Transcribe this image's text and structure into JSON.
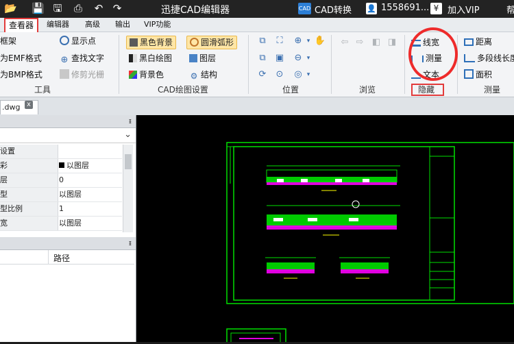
{
  "titlebar": {
    "title": "迅捷CAD编辑器",
    "cad_badge": "CAD",
    "convert_label": "CAD转换",
    "account": "1558691...",
    "vip_label": "加入VIP",
    "extra": "帮"
  },
  "menu": {
    "tabs": [
      "查看器",
      "编辑器",
      "高级",
      "输出",
      "VIP功能"
    ]
  },
  "ribbon": {
    "tools": {
      "items": [
        "框架",
        "为EMF格式",
        "为BMP格式",
        "显示点",
        "查找文字",
        "修剪光栅"
      ],
      "label": "工具"
    },
    "cad_settings": {
      "items": [
        "黑色背景",
        "圆滑弧形",
        "黑白绘图",
        "图层",
        "背景色",
        "结构"
      ],
      "label": "CAD绘图设置"
    },
    "position": {
      "label": "位置"
    },
    "browse": {
      "label": "浏览"
    },
    "hide": {
      "items": [
        "线宽",
        "测量",
        "文本"
      ],
      "label": "隐藏"
    },
    "measure": {
      "items": [
        "距离",
        "多段线长度",
        "面积"
      ],
      "label": "测量"
    }
  },
  "document": {
    "tab_label": ".dwg",
    "close": "x"
  },
  "properties": {
    "pin": "ᵻ",
    "dropdown_arrow": "⌄",
    "rows": [
      {
        "key": "设置",
        "value": ""
      },
      {
        "key": "彩",
        "value": "以图层"
      },
      {
        "key": "层",
        "value": "0"
      },
      {
        "key": "型",
        "value": "以图层"
      },
      {
        "key": "型比例",
        "value": "1"
      },
      {
        "key": "宽",
        "value": "以图层"
      }
    ]
  },
  "filelist": {
    "pin": "ᵻ",
    "path_header": "路径"
  },
  "colors": {
    "accent_red": "#e23a3a",
    "canvas_bg": "#000000",
    "drawing_green": "#00e000",
    "drawing_magenta": "#e000e0"
  }
}
